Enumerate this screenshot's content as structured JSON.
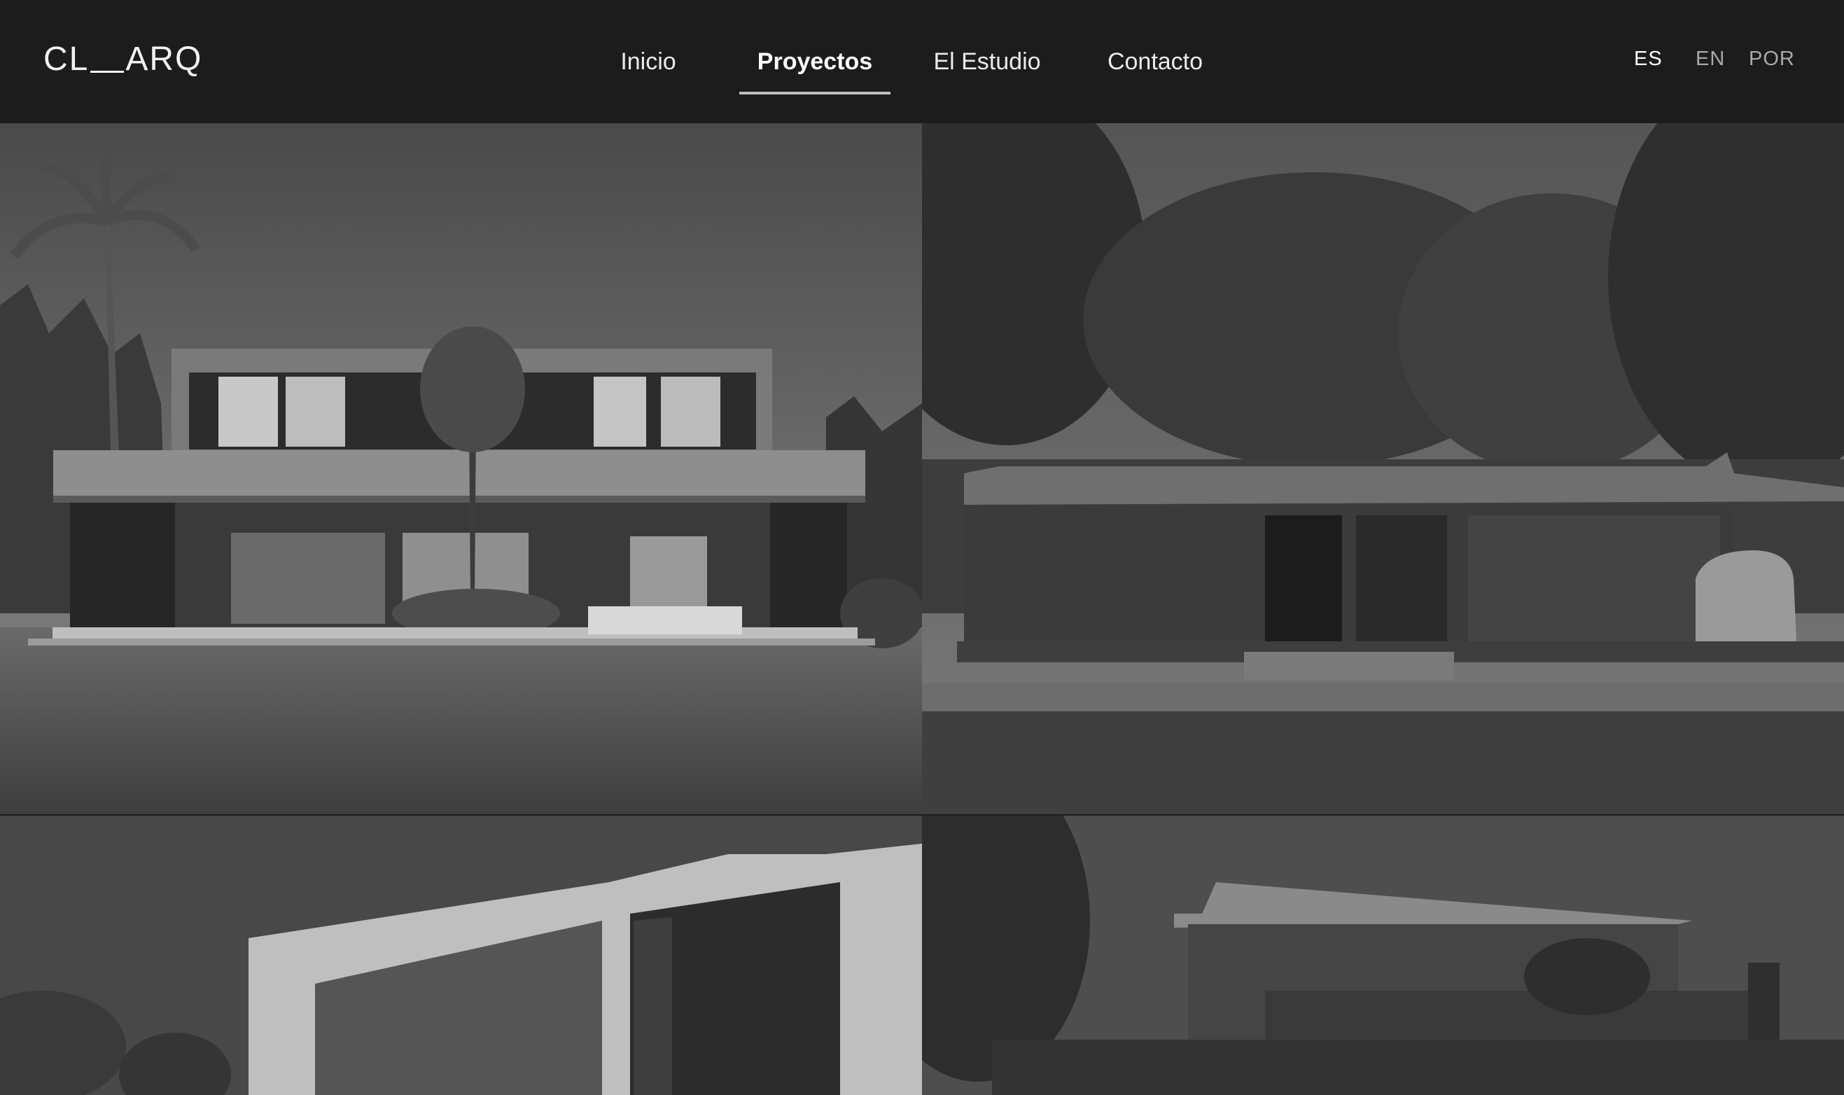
{
  "brand": {
    "logo_left": "CL",
    "logo_right": "ARQ"
  },
  "nav": {
    "items": [
      {
        "label": "Inicio"
      },
      {
        "label": "Proyectos",
        "active": true
      },
      {
        "label": "El Estudio"
      },
      {
        "label": "Contacto"
      }
    ]
  },
  "languages": [
    {
      "code": "ES",
      "active": true
    },
    {
      "code": "EN"
    },
    {
      "code": "POR"
    }
  ],
  "projects": [
    {
      "image": "two-story-house-with-pool-photo"
    },
    {
      "image": "single-story-house-with-garden-photo"
    },
    {
      "image": "white-modern-house-photo"
    },
    {
      "image": "wood-slat-house-photo"
    }
  ],
  "colors": {
    "header_bg": "#1c1c1c",
    "text": "#ebebeb",
    "active_underline": "#bdbdbd",
    "inactive_lang": "#a9a9a9"
  }
}
